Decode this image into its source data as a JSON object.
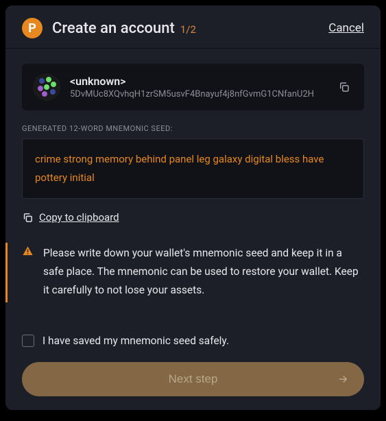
{
  "header": {
    "logo_letter": "P",
    "title": "Create an account",
    "step": "1/2",
    "cancel": "Cancel"
  },
  "account": {
    "name": "<unknown>",
    "address": "5DvMUc8XQvhqH1zrSM5usvF4Bnayuf4j8nfGvmG1CNfanU2H"
  },
  "seed": {
    "section_label": "GENERATED 12-WORD MNEMONIC SEED:",
    "phrase": "crime strong memory behind panel leg galaxy digital bless have pottery initial",
    "copy_label": "Copy to clipboard"
  },
  "warning": {
    "text": "Please write down your wallet's mnemonic seed and keep it in a safe place. The mnemonic can be used to restore your wallet. Keep it carefully to not lose your assets."
  },
  "confirm": {
    "label": "I have saved my mnemonic seed safely.",
    "checked": false
  },
  "next": {
    "label": "Next step"
  }
}
